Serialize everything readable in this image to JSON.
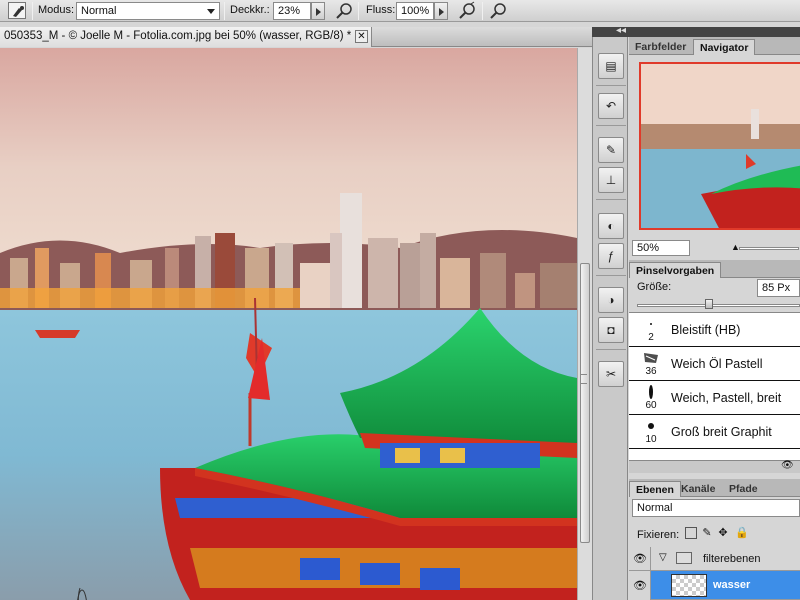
{
  "options_bar": {
    "mode_label": "Modus:",
    "mode_value": "Normal",
    "opacity_label": "Deckkr.:",
    "opacity_value": "23%",
    "flow_label": "Fluss:",
    "flow_value": "100%"
  },
  "document": {
    "tab_title": "050353_M - © Joelle M - Fotolia.com.jpg bei 50% (wasser, RGB/8) *",
    "close_glyph": "✕"
  },
  "dock": {
    "buttons": [
      "histogram-icon",
      "history-icon",
      "brush-presets-icon",
      "clone-source-icon",
      "styles-icon",
      "effects-icon",
      "mask-icon",
      "adjustments-icon",
      "tools-icon"
    ]
  },
  "navigator_panel": {
    "tabs": [
      "Farbfelder",
      "Navigator"
    ],
    "active_tab": "Navigator",
    "zoom_value": "50%"
  },
  "brushes_panel": {
    "tab_title": "Pinselvorgaben",
    "size_label": "Größe:",
    "size_value": "85 Px",
    "size_fraction": 0.44,
    "presets": [
      {
        "size": "2",
        "name": "Bleistift (HB)"
      },
      {
        "size": "36",
        "name": "Weich Öl Pastell"
      },
      {
        "size": "60",
        "name": "Weich, Pastell, breit"
      },
      {
        "size": "10",
        "name": "Groß breit Graphit"
      }
    ]
  },
  "layers_panel": {
    "tabs": [
      "Ebenen",
      "Kanäle",
      "Pfade"
    ],
    "active_tab": "Ebenen",
    "blend_mode": "Normal",
    "lock_label": "Fixieren:",
    "layers": [
      {
        "name": "filterebenen",
        "type": "group",
        "selected": false
      },
      {
        "name": "wasser",
        "type": "layer",
        "selected": true
      }
    ]
  },
  "colors": {
    "accent_selected_layer": "#3d8ee8",
    "navigator_frame": "#e03a2a"
  }
}
